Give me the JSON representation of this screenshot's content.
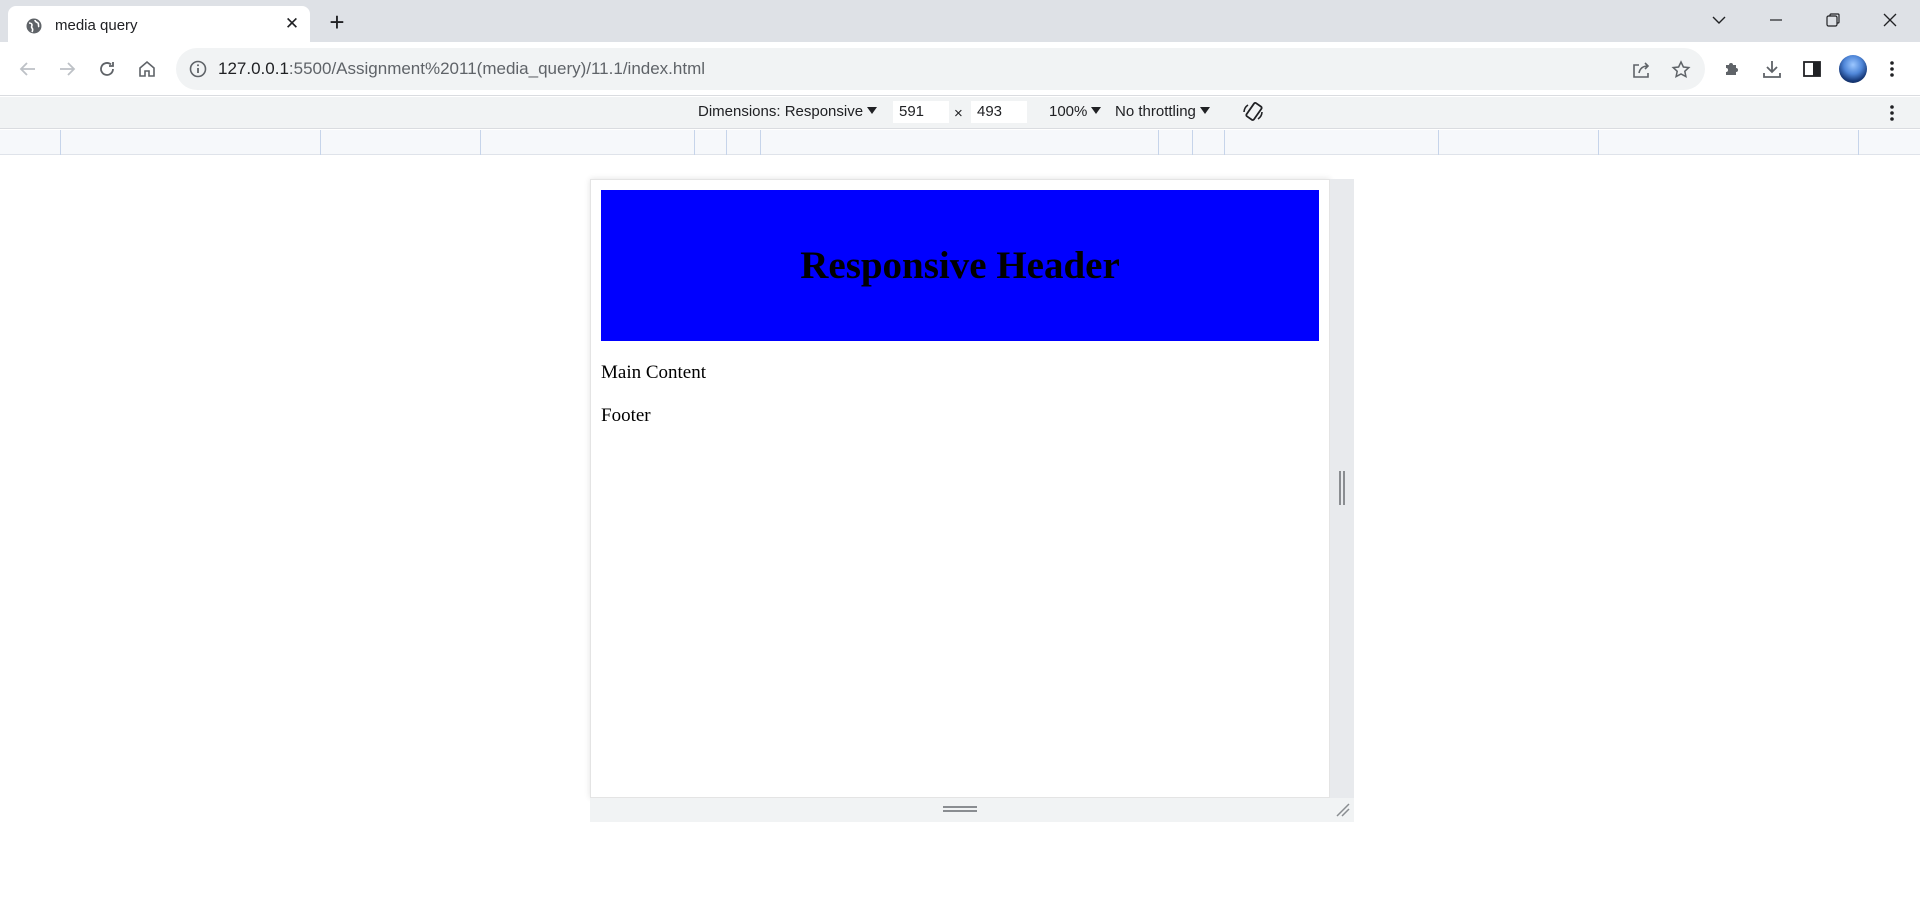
{
  "browser": {
    "tab": {
      "title": "media query"
    },
    "address": {
      "host": "127.0.0.1",
      "path": ":5500/Assignment%2011(media_query)/11.1/index.html"
    }
  },
  "devtools": {
    "dimensions_label": "Dimensions: Responsive",
    "width": "591",
    "height": "493",
    "times": "×",
    "zoom": "100%",
    "throttling": "No throttling"
  },
  "page": {
    "header": "Responsive Header",
    "main": "Main Content",
    "footer": "Footer"
  },
  "colors": {
    "header_bg": "#0000ff",
    "tabstrip_bg": "#dee1e6",
    "omnibox_bg": "#f1f3f4"
  },
  "icons": [
    "globe-icon",
    "close-icon",
    "plus-icon",
    "chevron-down-icon",
    "minimize-icon",
    "restore-icon",
    "back-icon",
    "forward-icon",
    "reload-icon",
    "home-icon",
    "info-icon",
    "share-icon",
    "star-icon",
    "extensions-icon",
    "download-icon",
    "side-panel-icon",
    "menu-icon",
    "rotate-icon"
  ]
}
